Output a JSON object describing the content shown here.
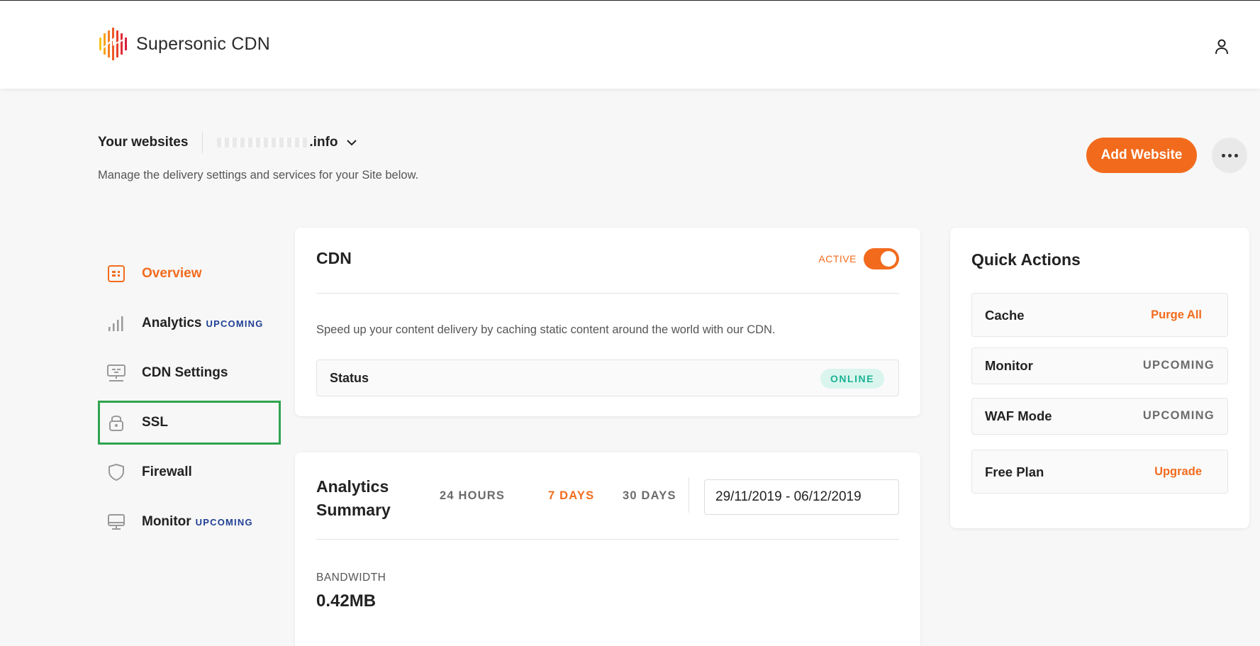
{
  "header": {
    "brand": "Supersonic CDN",
    "logo_icon": "supersonic-logo-icon",
    "user_icon": "user-icon"
  },
  "site": {
    "label": "Your websites",
    "selected_suffix": ".info",
    "dropdown_icon": "chevron-down-icon",
    "subtitle": "Manage the delivery settings and services for your Site below.",
    "add_button": "Add Website",
    "more_icon": "more-horizontal-icon"
  },
  "sidebar": {
    "items": [
      {
        "label": "Overview",
        "icon": "overview-icon",
        "badge": "",
        "active": true
      },
      {
        "label": "Analytics",
        "icon": "bar-chart-icon",
        "badge": "UPCOMING",
        "active": false
      },
      {
        "label": "CDN Settings",
        "icon": "cdn-settings-icon",
        "badge": "",
        "active": false
      },
      {
        "label": "SSL",
        "icon": "lock-icon",
        "badge": "",
        "active": false
      },
      {
        "label": "Firewall",
        "icon": "shield-icon",
        "badge": "",
        "active": false
      },
      {
        "label": "Monitor",
        "icon": "monitor-icon",
        "badge": "UPCOMING",
        "active": false
      }
    ]
  },
  "cdn_card": {
    "title": "CDN",
    "toggle_label": "ACTIVE",
    "toggle_on": true,
    "description": "Speed up your content delivery by caching static content around the world with our CDN.",
    "status_label": "Status",
    "status_value": "ONLINE"
  },
  "analytics_card": {
    "title": "Analytics Summary",
    "ranges": [
      "24 HOURS",
      "7 DAYS",
      "30 DAYS"
    ],
    "active_range": "7 DAYS",
    "date_range": "29/11/2019 - 06/12/2019",
    "bandwidth_label": "BANDWIDTH",
    "bandwidth_value": "0.42MB"
  },
  "quick_actions": {
    "title": "Quick Actions",
    "rows": [
      {
        "name": "Cache",
        "action": "Purge All"
      },
      {
        "name": "Monitor",
        "action": "UPCOMING"
      },
      {
        "name": "WAF Mode",
        "action": "UPCOMING"
      },
      {
        "name": "Free Plan",
        "action": "Upgrade"
      }
    ]
  },
  "colors": {
    "accent": "#f26b1d",
    "badge_blue": "#1f3f95",
    "online_green": "#1ab394",
    "highlight_green": "#2ea44f"
  }
}
